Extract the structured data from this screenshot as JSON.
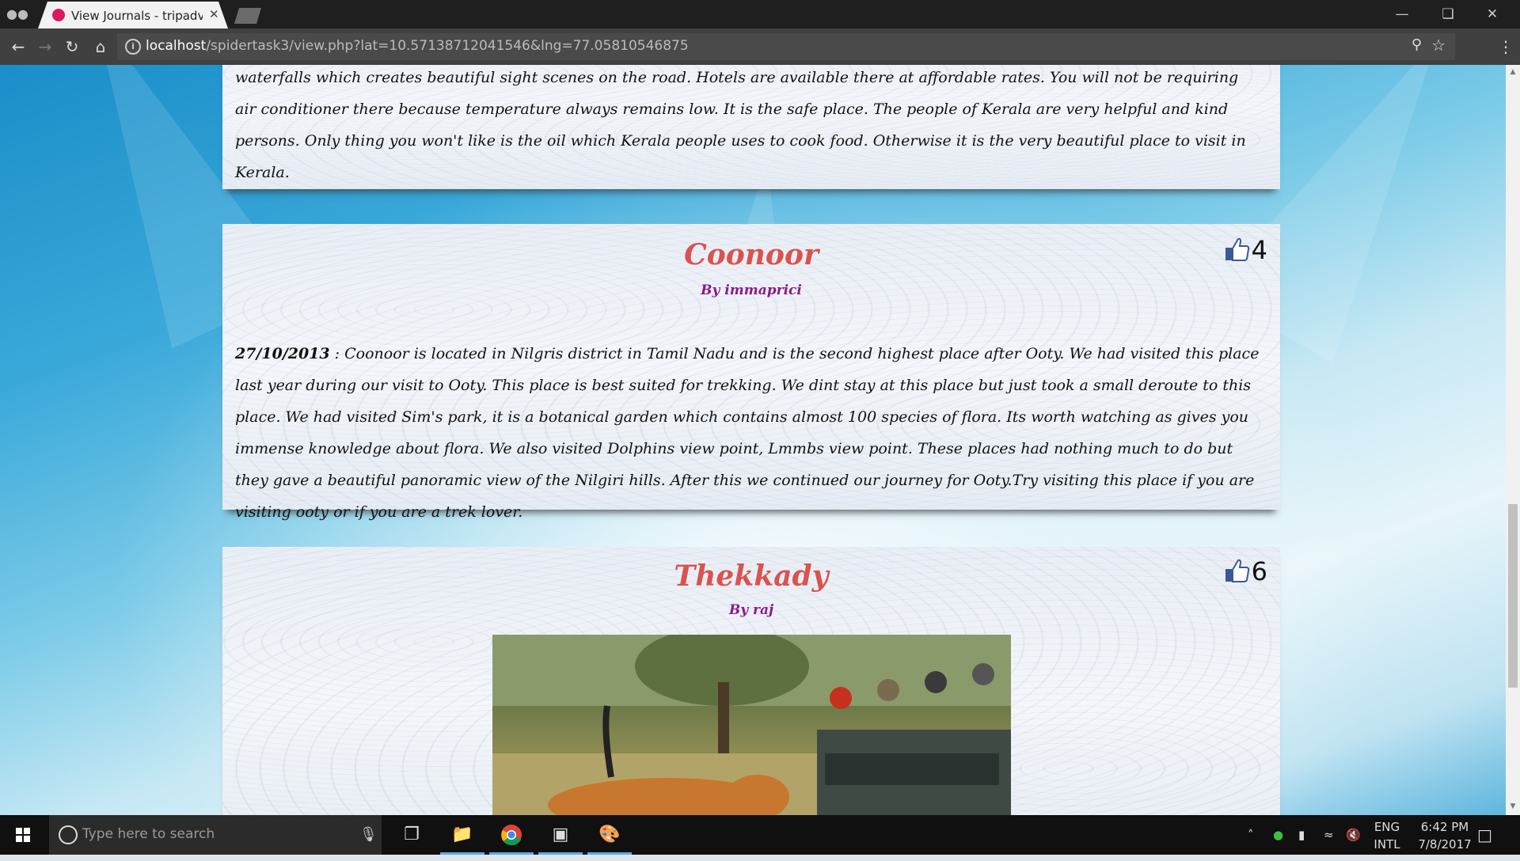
{
  "browser": {
    "tab_title": "View Journals - tripadvis",
    "url_host": "localhost",
    "url_path": "/spidertask3/view.php?lat=10.57138712041546&lng=77.05810546875"
  },
  "cards": [
    {
      "body": "how they are preparing tea and offer you to taste it. You can visit tea factories. On the way reaching to Munnar, you will find lots of waterfalls which creates beautiful sight scenes on the road. Hotels are available there at affordable rates. You will not be requiring air conditioner there because temperature always remains low. It is the safe place. The people of Kerala are very helpful and kind persons. Only thing you won't like is the oil which Kerala people uses to cook food. Otherwise it is the very beautiful place to visit in Kerala."
    },
    {
      "title": "Coonoor",
      "author": "By immaprici",
      "likes": "4",
      "date": "27/10/2013",
      "body": " : Coonoor is located in Nilgris district in Tamil Nadu and is the second highest place after Ooty. We had visited this place last year during our visit to Ooty. This place is best suited for trekking. We dint stay at this place but just took a small deroute to this place. We had visited Sim's park, it is a botanical garden which contains almost 100 species of flora. Its worth watching as gives you immense knowledge about flora. We also visited Dolphins view point, Lmmbs view point. These places had nothing much to do but they gave a beautiful panoramic view of the Nilgiri hills. After this we continued our journey for Ooty.Try visiting this place if you are visiting ooty or if you are a trek lover."
    },
    {
      "title": "Thekkady",
      "author": "By raj",
      "likes": "6"
    }
  ],
  "taskbar": {
    "search_placeholder": "Type here to search",
    "lang_top": "ENG",
    "lang_bottom": "INTL",
    "time": "6:42 PM",
    "date": "7/8/2017"
  }
}
